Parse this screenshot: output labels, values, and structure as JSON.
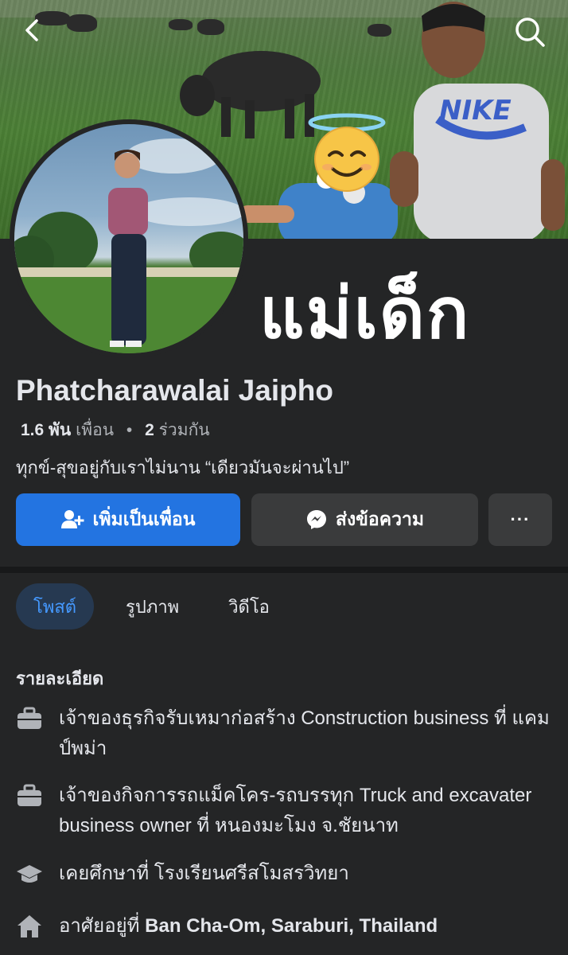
{
  "cover": {
    "overlay_text": "แม่เด็ก"
  },
  "profile": {
    "name": "Phatcharawalai Jaipho",
    "friends_count": "1.6 พัน",
    "friends_label": "เพื่อน",
    "mutual_count": "2",
    "mutual_label": "ร่วมกัน",
    "bio": "ทุกข์-สุขอยู่กับเราไม่นาน “เดียวมันจะผ่านไป”"
  },
  "actions": {
    "add_friend_label": "เพิ่มเป็นเพื่อน",
    "message_label": "ส่งข้อความ",
    "more_label": "···"
  },
  "tabs": [
    {
      "label": "โพสต์",
      "active": true
    },
    {
      "label": "รูปภาพ",
      "active": false
    },
    {
      "label": "วิดีโอ",
      "active": false
    }
  ],
  "details": {
    "title": "รายละเอียด",
    "items": [
      {
        "icon": "briefcase-icon",
        "text": "เจ้าของธุรกิจรับเหมาก่อสร้าง Construction business ที่ แคมป์พม่า"
      },
      {
        "icon": "briefcase-icon",
        "text": "เจ้าของกิจการรถแม็คโคร-รถบรรทุก Truck and excavater business owner ที่ หนองมะโมง จ.ชัยนาท"
      },
      {
        "icon": "graduation-cap-icon",
        "text": "เคยศึกษาที่ โรงเรียนศรีสโมสรวิทยา"
      },
      {
        "icon": "home-icon",
        "prefix": "อาศัยอยู่ที่ ",
        "place": "Ban Cha-Om, Saraburi, Thailand"
      }
    ]
  },
  "colors": {
    "accent": "#2374e1",
    "background": "#242526",
    "tab_active_bg": "#263951",
    "tab_active_text": "#4599ff"
  }
}
